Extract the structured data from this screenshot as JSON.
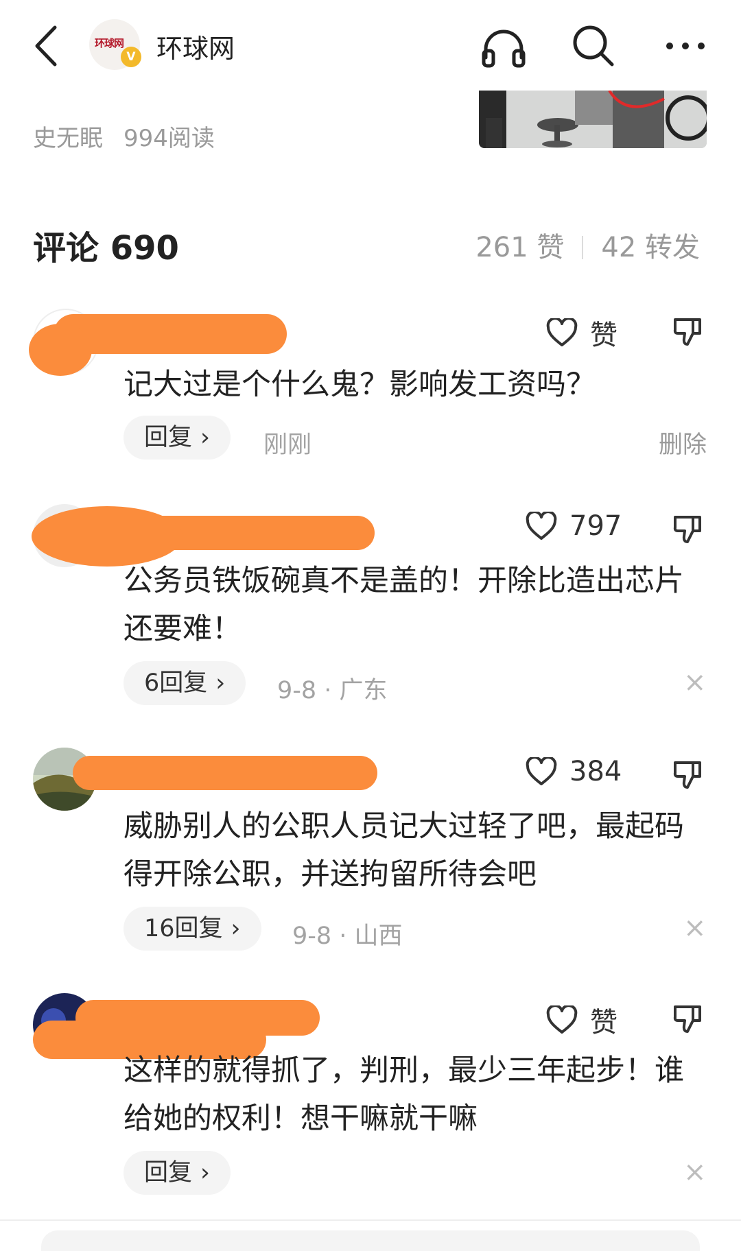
{
  "header": {
    "brand_name": "环球网",
    "logo_text": "环球网",
    "badge": "V"
  },
  "article": {
    "author": "史无眠",
    "reads": "994阅读"
  },
  "comments_header": {
    "title": "评论 690",
    "likes": "261 赞",
    "shares": "42 转发"
  },
  "comments": [
    {
      "like": "赞",
      "text": "记大过是个什么鬼？影响发工资吗？",
      "reply": "回复",
      "time": "刚刚",
      "action": "删除"
    },
    {
      "like": "797",
      "text": "公务员铁饭碗真不是盖的！开除比造出芯片还要难！",
      "reply": "6回复",
      "time": "9-8 · 广东",
      "action": "×"
    },
    {
      "like": "384",
      "text": "威胁别人的公职人员记大过轻了吧，最起码得开除公职，并送拘留所待会吧",
      "reply": "16回复",
      "time": "9-8 · 山西",
      "action": "×"
    },
    {
      "like": "赞",
      "text": "这样的就得抓了，判刑，最少三年起步！谁给她的权利！想干嘛就干嘛",
      "reply": "回复",
      "time": "",
      "action": "×"
    }
  ]
}
